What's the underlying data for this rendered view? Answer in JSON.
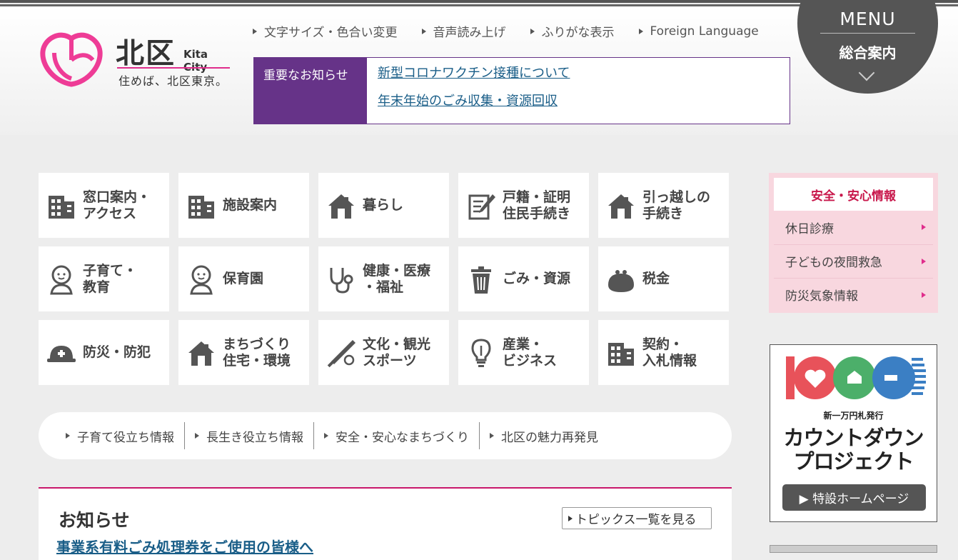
{
  "header": {
    "logo_name": "北区",
    "logo_en": "Kita City",
    "logo_tagline": "住めば、北区東京。",
    "util_links": [
      "文字サイズ・色合い変更",
      "音声読み上げ",
      "ふりがな表示",
      "Foreign Language"
    ]
  },
  "menu_button": {
    "label_en": "MENU",
    "label_jp": "総合案内"
  },
  "notice": {
    "label": "重要なお知らせ",
    "links": [
      "新型コロナワクチン接種について",
      "年末年始のごみ収集・資源回収"
    ]
  },
  "tiles": [
    {
      "label": "窓口案内・\nアクセス",
      "icon": "building-icon"
    },
    {
      "label": "施設案内",
      "icon": "building-icon"
    },
    {
      "label": "暮らし",
      "icon": "house-icon"
    },
    {
      "label": "戸籍・証明\n住民手続き",
      "icon": "document-pen-icon"
    },
    {
      "label": "引っ越しの\n手続き",
      "icon": "house-icon"
    },
    {
      "label": "子育て・\n教育",
      "icon": "baby-icon"
    },
    {
      "label": "保育園",
      "icon": "baby-icon"
    },
    {
      "label": "健康・医療\n・福祉",
      "icon": "stethoscope-icon"
    },
    {
      "label": "ごみ・資源",
      "icon": "trash-can-icon"
    },
    {
      "label": "税金",
      "icon": "coin-purse-icon"
    },
    {
      "label": "防災・防犯",
      "icon": "helmet-icon"
    },
    {
      "label": "まちづくり\n住宅・環境",
      "icon": "house-icon"
    },
    {
      "label": "文化・観光\nスポーツ",
      "icon": "baseball-bat-icon"
    },
    {
      "label": "産業・\nビジネス",
      "icon": "lightbulb-icon"
    },
    {
      "label": "契約・\n入札情報",
      "icon": "building-icon"
    }
  ],
  "quick_links": [
    "子育て役立ち情報",
    "長生き役立ち情報",
    "安全・安心なまちづくり",
    "北区の魅力再発見"
  ],
  "news": {
    "title": "お知らせ",
    "more_label": "トピックス一覧を見る",
    "first_item": "事業系有料ごみ処理券をご使用の皆様へ"
  },
  "safety": {
    "title": "安全・安心情報",
    "items": [
      "休日診療",
      "子どもの夜間救急",
      "防災気象情報"
    ]
  },
  "banner": {
    "number": "10000",
    "subtitle": "新一万円札発行",
    "line1": "カウントダウン",
    "line2": "プロジェクト",
    "button_label": "▶ 特設ホームページ"
  },
  "colors": {
    "purple": "#663388",
    "pink": "#e02d8c",
    "crimson": "#c8174b",
    "link": "#1a5e88",
    "banner_red": "#e8525a",
    "banner_green": "#4caf6a",
    "banner_blue": "#3b7fc4"
  }
}
